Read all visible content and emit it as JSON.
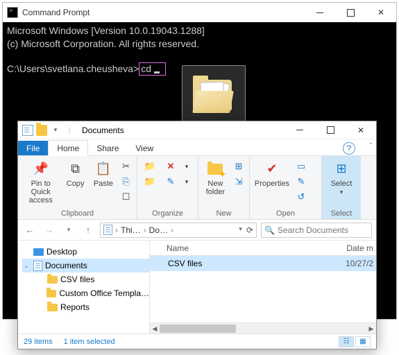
{
  "cmd": {
    "title": "Command Prompt",
    "line1": "Microsoft Windows [Version 10.0.19043.1288]",
    "line2": "(c) Microsoft Corporation. All rights reserved.",
    "prompt": "C:\\Users\\svetlana.cheusheva>",
    "typed": "cd "
  },
  "explorer": {
    "title": "Documents",
    "tabs": {
      "file": "File",
      "home": "Home",
      "share": "Share",
      "view": "View"
    },
    "ribbon": {
      "clipboard": {
        "label": "Clipboard",
        "pin": "Pin to Quick\naccess",
        "copy": "Copy",
        "paste": "Paste"
      },
      "organize": {
        "label": "Organize"
      },
      "new": {
        "label": "New",
        "newfolder": "New\nfolder"
      },
      "open": {
        "label": "Open",
        "properties": "Properties"
      },
      "select": {
        "label": "Select",
        "select": "Select"
      }
    },
    "breadcrumb": {
      "b1": "Thi…",
      "b2": "Do…"
    },
    "search_placeholder": "Search Documents",
    "tree": {
      "desktop": "Desktop",
      "documents": "Documents",
      "csv": "CSV files",
      "tpl": "Custom Office Templa…",
      "reports": "Reports"
    },
    "list": {
      "col_name": "Name",
      "col_date": "Date m",
      "rows": [
        {
          "name": "CSV files",
          "date": "10/27/2"
        }
      ]
    },
    "status": {
      "count": "29 items",
      "selected": "1 item selected"
    }
  }
}
